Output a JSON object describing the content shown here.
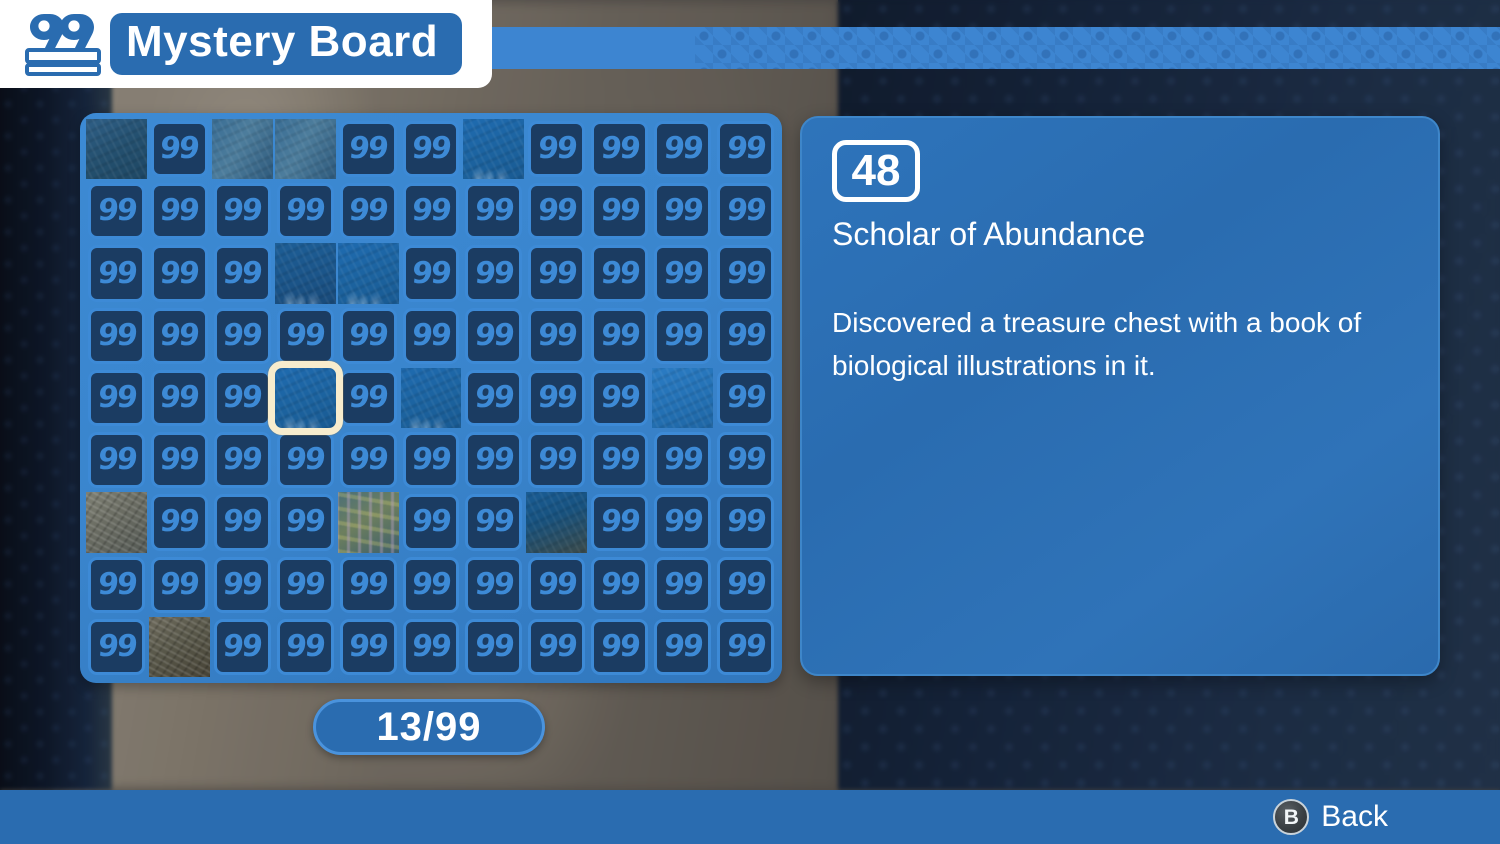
{
  "header": {
    "icon": "board-99-icon",
    "title": "Mystery Board"
  },
  "board": {
    "columns": 11,
    "rows": 9,
    "hidden_tile_glyph": "99",
    "cursor": {
      "row": 4,
      "col": 3
    },
    "cells": [
      [
        "revealed:water",
        "hidden",
        "revealed:water2",
        "revealed:water2",
        "hidden",
        "hidden",
        "revealed:plain",
        "hidden",
        "hidden",
        "hidden",
        "hidden"
      ],
      [
        "hidden",
        "hidden",
        "hidden",
        "hidden",
        "hidden",
        "hidden",
        "hidden",
        "hidden",
        "hidden",
        "hidden",
        "hidden"
      ],
      [
        "hidden",
        "hidden",
        "hidden",
        "revealed:deep",
        "revealed:plain",
        "hidden",
        "hidden",
        "hidden",
        "hidden",
        "hidden",
        "hidden"
      ],
      [
        "hidden",
        "hidden",
        "hidden",
        "hidden",
        "hidden",
        "hidden",
        "hidden",
        "hidden",
        "hidden",
        "hidden",
        "hidden"
      ],
      [
        "hidden",
        "hidden",
        "hidden",
        "revealed:plain",
        "hidden",
        "revealed:plain",
        "hidden",
        "hidden",
        "hidden",
        "revealed:plain2",
        "hidden"
      ],
      [
        "hidden",
        "hidden",
        "hidden",
        "hidden",
        "hidden",
        "hidden",
        "hidden",
        "hidden",
        "hidden",
        "hidden",
        "hidden"
      ],
      [
        "revealed:sand",
        "hidden",
        "hidden",
        "hidden",
        "revealed:coral",
        "hidden",
        "hidden",
        "revealed:reef",
        "hidden",
        "hidden",
        "hidden"
      ],
      [
        "hidden",
        "hidden",
        "hidden",
        "hidden",
        "hidden",
        "hidden",
        "hidden",
        "hidden",
        "hidden",
        "hidden",
        "hidden"
      ],
      [
        "hidden",
        "revealed:sand2",
        "hidden",
        "hidden",
        "hidden",
        "hidden",
        "hidden",
        "hidden",
        "hidden",
        "hidden",
        "hidden"
      ]
    ]
  },
  "counter": {
    "label": "13/99",
    "found": 13,
    "total": 99
  },
  "info": {
    "number": "48",
    "title": "Scholar of Abundance",
    "description": "Discovered a treasure chest with a book of biological illustrations in it."
  },
  "footer": {
    "button_glyph": "B",
    "back_label": "Back"
  },
  "colors": {
    "accent_blue": "#2a6cb0",
    "light_blue": "#3d85d1",
    "tile_face": "#1b3c62",
    "tile_border": "#3d8ad6",
    "cursor": "#f7eccd",
    "white": "#ffffff"
  }
}
